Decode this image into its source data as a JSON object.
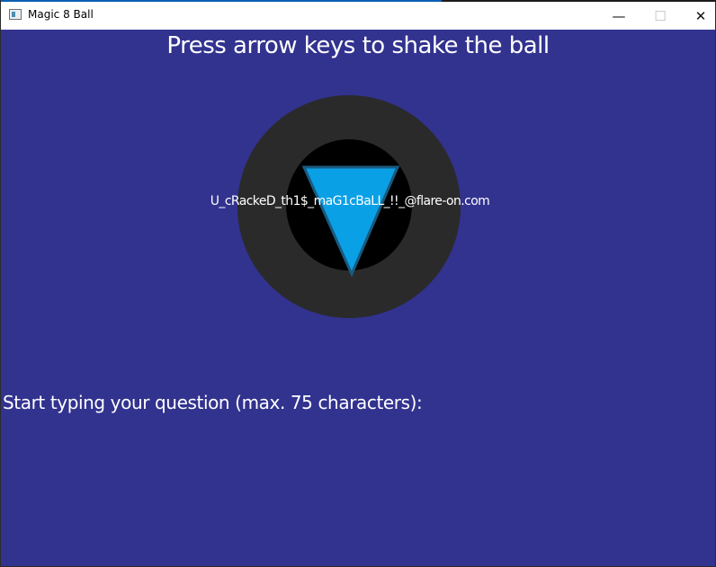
{
  "window": {
    "title": "Magic 8 Ball",
    "minimize_glyph": "—",
    "maximize_glyph": "☐",
    "close_glyph": "✕"
  },
  "game": {
    "instructions": "Press arrow keys to shake the ball",
    "answer": "U_cRackeD_th1$_maG1cBaLL_!!_@flare-on.com",
    "question_prompt": "Start typing your question (max. 75 characters):"
  },
  "colors": {
    "background": "#32328f",
    "ball_outer": "#2a2a2a",
    "ball_window": "#000000",
    "triangle": "#0aa0e6",
    "triangle_edge": "#1a5a80",
    "text": "#ffffff"
  }
}
